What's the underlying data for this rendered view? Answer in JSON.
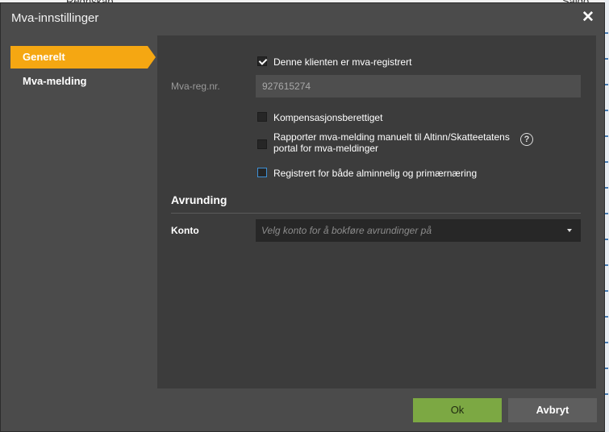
{
  "background": {
    "left_text": "Regnskap",
    "right_text": "Saldo"
  },
  "dialog": {
    "title": "Mva-innstillinger",
    "close_label": "✕"
  },
  "nav": {
    "items": [
      {
        "label": "Generelt",
        "active": true
      },
      {
        "label": "Mva-melding",
        "active": false
      }
    ]
  },
  "general": {
    "registered": {
      "label": "Denne klienten er mva-registrert",
      "checked": true
    },
    "vat_number": {
      "label": "Mva-reg.nr.",
      "value": "927615274"
    },
    "compensation": {
      "label": "Kompensasjonsberettiget",
      "checked": false
    },
    "manual_report": {
      "label_line1": "Rapporter mva-melding manuelt til Altinn/Skatteetatens",
      "label_line2": "portal for mva-meldinger",
      "checked": false,
      "help_icon": "?"
    },
    "both_registered": {
      "label": "Registrert for både alminnelig og primærnæring",
      "checked": false
    },
    "rounding": {
      "title": "Avrunding",
      "account_label": "Konto",
      "account_placeholder": "Velg konto for å bokføre avrundinger på"
    }
  },
  "buttons": {
    "ok": "Ok",
    "cancel": "Avbryt"
  },
  "colors": {
    "active_tab": "#f5a712",
    "ok_button": "#7ca843",
    "dialog_bg": "#4b4b4b",
    "panel_bg": "#3c3c3c"
  }
}
